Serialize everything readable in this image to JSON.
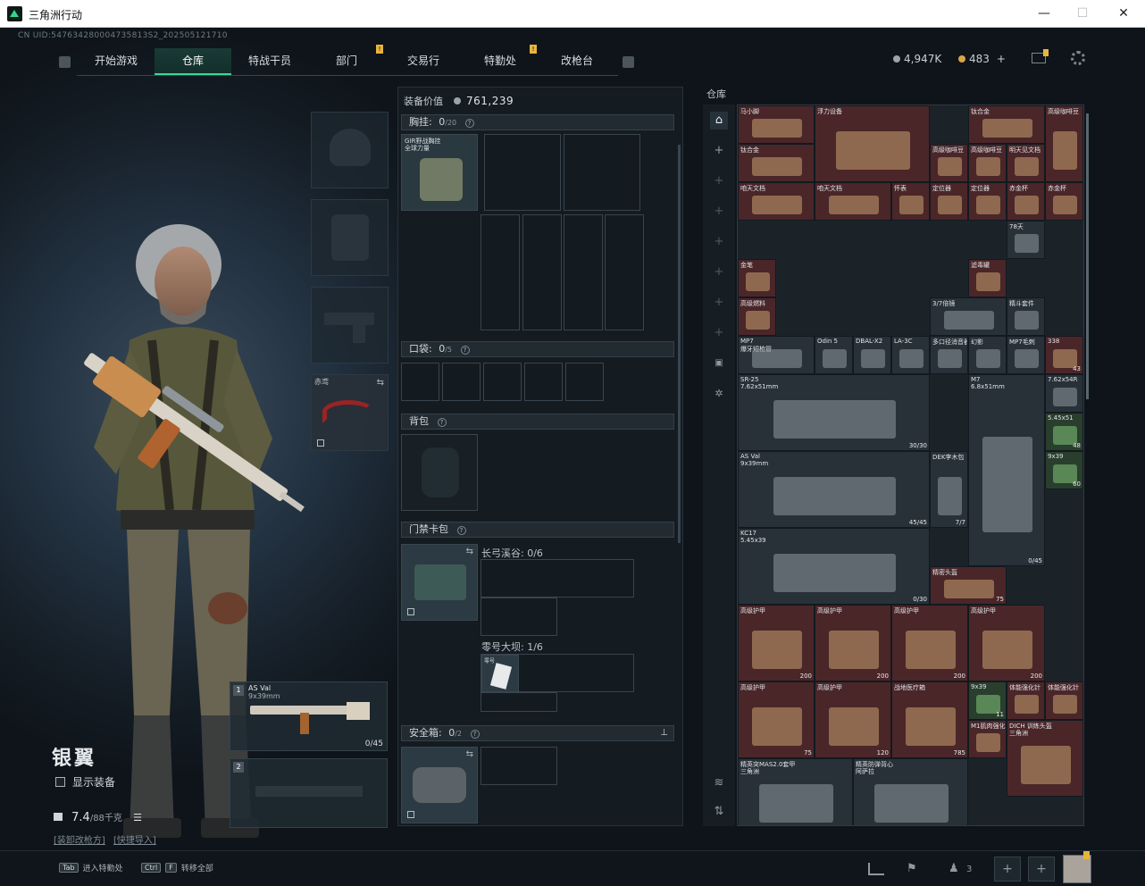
{
  "window": {
    "title": "三角洲行动",
    "minimize": "—",
    "maximize": "☐",
    "close": "✕"
  },
  "uid": "CN UID:547634280004735813S2_202505121710",
  "nav": {
    "tabs": [
      {
        "label": "开始游戏",
        "active": false,
        "badge": ""
      },
      {
        "label": "仓库",
        "active": true,
        "badge": ""
      },
      {
        "label": "特战干员",
        "active": false,
        "badge": ""
      },
      {
        "label": "部门",
        "active": false,
        "badge": "!"
      },
      {
        "label": "交易行",
        "active": false,
        "badge": ""
      },
      {
        "label": "特勤处",
        "active": false,
        "badge": "!"
      },
      {
        "label": "改枪台",
        "active": false,
        "badge": ""
      }
    ]
  },
  "currency": {
    "coins": "4,947K",
    "tickets": "483",
    "plus": "+"
  },
  "character": {
    "name": "银翼",
    "show_equipment": "显示装备",
    "weight": "7.4",
    "weight_max": "/88千克",
    "link1": "[装卸改枪方]",
    "link2": "[快捷导入]"
  },
  "equipment_slots": {
    "melee_label": "赤鸢",
    "weapon1_name": "AS Val",
    "weapon1_caliber": "9x39mm",
    "weapon1_ammo": "0/45",
    "weapon1_num": "1",
    "weapon2_num": "2"
  },
  "middle": {
    "value_label": "装备价值",
    "value": "761,239",
    "chest": {
      "label": "胸挂:",
      "count": "0",
      "cap": "/20",
      "item": "GIR野战胸挂",
      "item_sub": "全球力量"
    },
    "pocket": {
      "label": "口袋:",
      "count": "0",
      "cap": "/5"
    },
    "backpack": {
      "label": "背包"
    },
    "keycard": {
      "label": "门禁卡包",
      "zone1": "长弓溪谷: 0/6",
      "zone2": "零号大坝: 1/6",
      "card_label": "零号"
    },
    "safebox": {
      "label": "安全箱:",
      "count": "0",
      "cap": "/2"
    }
  },
  "stash": {
    "title": "仓库",
    "items": [
      {
        "name": "马小脚",
        "rarity": "red"
      },
      {
        "name": "浮力设备",
        "rarity": "red"
      },
      {
        "name": "钛合金",
        "rarity": "red"
      },
      {
        "name": "高级咖啡豆",
        "rarity": "red"
      },
      {
        "name": "钛合金",
        "rarity": "red"
      },
      {
        "name": "高级咖啡豆",
        "rarity": "red"
      },
      {
        "name": "高级咖啡豆",
        "rarity": "red"
      },
      {
        "name": "明天见文档",
        "rarity": "red"
      },
      {
        "name": "咱天文档",
        "rarity": "red"
      },
      {
        "name": "咱天文档",
        "rarity": "red"
      },
      {
        "name": "怀表",
        "rarity": "red"
      },
      {
        "name": "定位器",
        "rarity": "red"
      },
      {
        "name": "定位器",
        "rarity": "red"
      },
      {
        "name": "赤金杯",
        "rarity": "red"
      },
      {
        "name": "赤金杯",
        "rarity": "red"
      },
      {
        "name": "金笔",
        "rarity": "red"
      },
      {
        "name": "滤毒罐",
        "rarity": "red"
      },
      {
        "name": "高级燃料",
        "rarity": "red"
      },
      {
        "name": "3/7倍镜",
        "rarity": "gray"
      },
      {
        "name": "精斗套件",
        "rarity": "gray"
      },
      {
        "name": "MP7",
        "sub": "爆牙短枪管",
        "rarity": "gray"
      },
      {
        "name": "Odin 5",
        "rarity": "gray"
      },
      {
        "name": "DBAL-X2",
        "rarity": "gray"
      },
      {
        "name": "LA-3C",
        "rarity": "gray"
      },
      {
        "name": "多口径消音器",
        "rarity": "gray"
      },
      {
        "name": "幻影",
        "rarity": "gray"
      },
      {
        "name": "MP7毛刺",
        "rarity": "gray"
      },
      {
        "name": "SR-25",
        "sub": "7.62x51mm",
        "count": "30/30",
        "rarity": "gray"
      },
      {
        "name": "M7",
        "sub": "6.8x51mm",
        "count": "0/45",
        "rarity": "gray"
      },
      {
        "name": "AS Val",
        "sub": "9x39mm",
        "count": "45/45",
        "rarity": "gray"
      },
      {
        "name": "DEK李木包",
        "count": "7/7",
        "rarity": "gray"
      },
      {
        "name": "KC17",
        "sub": "5.45x39",
        "count": "0/30",
        "rarity": "gray"
      },
      {
        "name": "精密头盔",
        "count": "75",
        "rarity": "red"
      },
      {
        "name": "高级护甲",
        "count": "200",
        "rarity": "red"
      },
      {
        "name": "高级护甲",
        "count": "200",
        "rarity": "red"
      },
      {
        "name": "高级护甲",
        "count": "200",
        "rarity": "red"
      },
      {
        "name": "高级护甲",
        "count": "200",
        "rarity": "red"
      },
      {
        "name": "高级护甲",
        "count": "75",
        "rarity": "red"
      },
      {
        "name": "高级护甲",
        "count": "120",
        "rarity": "red"
      },
      {
        "name": "战地医疗箱",
        "count": "785",
        "rarity": "red"
      },
      {
        "name": "9x39",
        "count": "11",
        "rarity": "green"
      },
      {
        "name": "体能强化针",
        "rarity": "red"
      },
      {
        "name": "体能强化针",
        "rarity": "red"
      },
      {
        "name": "M1肌肉强化",
        "rarity": "red"
      },
      {
        "name": "DICH 训练头盔",
        "sub": "三角洲",
        "rarity": "red"
      },
      {
        "name": "精英突MAS2.0套甲",
        "sub": "三角洲",
        "rarity": "gray"
      },
      {
        "name": "精英防弹背心",
        "sub": "阿萨拉",
        "rarity": "gray"
      },
      {
        "name": "338",
        "count": "43",
        "rarity": "red"
      },
      {
        "name": "7.62x54R",
        "rarity": "gray"
      },
      {
        "name": "5.45x51",
        "count": "48",
        "rarity": "green"
      },
      {
        "name": "9x39",
        "count": "60",
        "rarity": "green"
      },
      {
        "name": "78天",
        "rarity": "gray"
      }
    ]
  },
  "bottom": {
    "hint1_key": "Tab",
    "hint1_label": "进入特勤处",
    "hint2_key": "Ctrl",
    "hint2_key2": "F",
    "hint2_label": "转移全部",
    "team_count": "3"
  },
  "colors": {
    "accent": "#39d59a",
    "badge": "#e8b53c",
    "rare_red": "#4a2629",
    "rare_gold": "#4a3a22"
  }
}
